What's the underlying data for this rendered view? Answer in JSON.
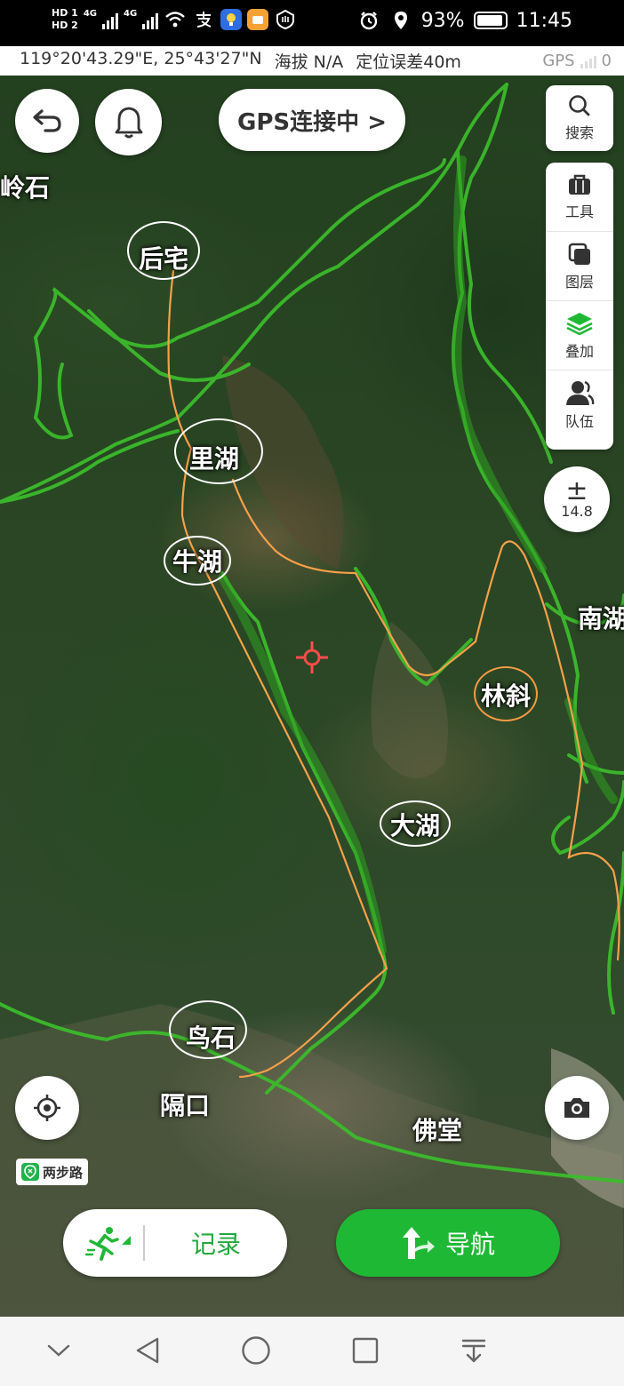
{
  "status_bar": {
    "sim1": "HD 1",
    "sim2": "HD 2",
    "net1": "4G",
    "net2": "4G",
    "battery": "93%",
    "time": "11:45"
  },
  "info_bar": {
    "longitude": "119°20'43.29\"E, 25°43'27\"N",
    "altitude": "海拔 N/A",
    "accuracy": "定位误差40m",
    "gps_label": "GPS",
    "gps_count": "0"
  },
  "toolbar": {
    "gps_status": "GPS连接中 >"
  },
  "side_panel": {
    "search": "搜索",
    "tools": "工具",
    "layers": "图层",
    "overlay": "叠加",
    "team": "队伍"
  },
  "zoom": {
    "level": "14.8"
  },
  "map": {
    "places": {
      "a": "后宅",
      "b": "里湖",
      "c": "牛湖",
      "d": "林斜",
      "e": "大湖",
      "f": "鸟石",
      "g": "隔口",
      "h": "佛堂",
      "i": "南湖",
      "j": "岭石"
    }
  },
  "brand": "两步路",
  "bottom_actions": {
    "record": "记录",
    "navigate": "导航"
  },
  "colors": {
    "accent_green": "#1fb835",
    "route_orange": "#f5a04a",
    "trail_green": "#3cba2c"
  }
}
